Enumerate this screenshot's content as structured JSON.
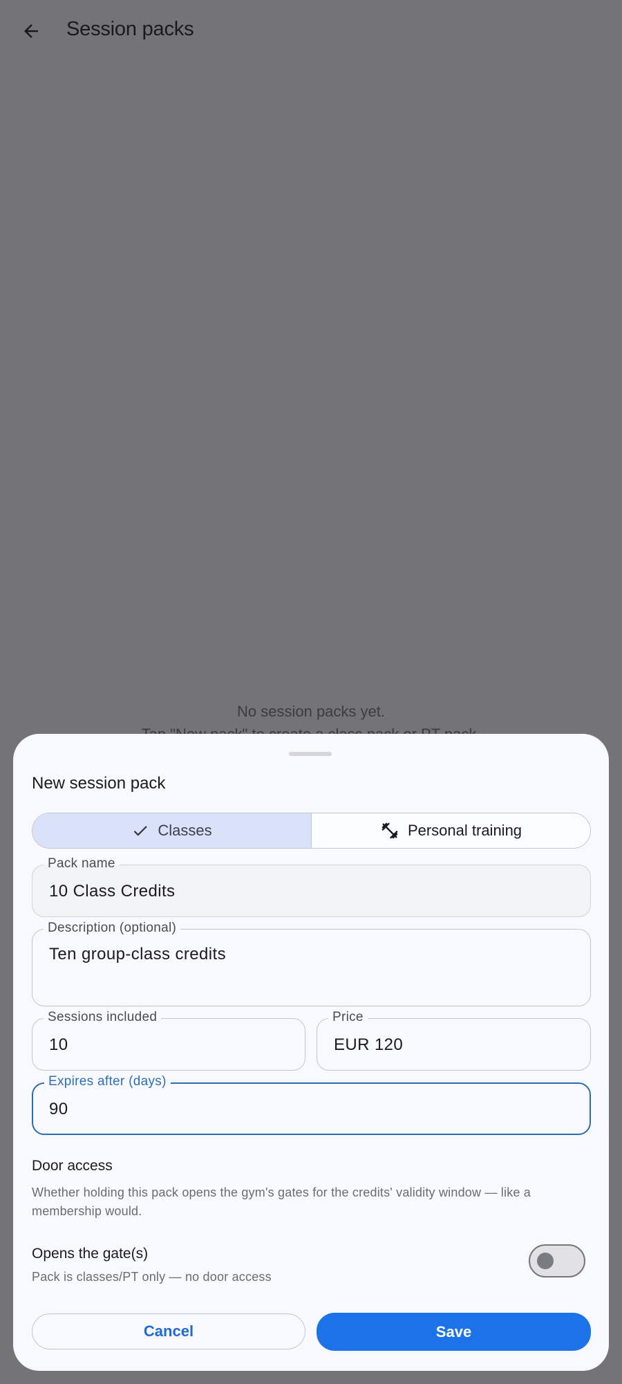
{
  "app_bar": {
    "title": "Session packs"
  },
  "empty_state": {
    "line1": "No session packs yet.",
    "line2": "Tap \"New pack\" to create a class pack or PT pack."
  },
  "sheet": {
    "title": "New session pack",
    "segments": [
      {
        "label": "Classes",
        "icon": "check-icon",
        "selected": true
      },
      {
        "label": "Personal training",
        "icon": "dumbbell-icon",
        "selected": false
      }
    ],
    "fields": {
      "pack_name": {
        "label": "Pack name",
        "value": "10 Class Credits"
      },
      "description": {
        "label": "Description (optional)",
        "value": "Ten group-class credits"
      },
      "sessions": {
        "label": "Sessions included",
        "value": "10"
      },
      "price": {
        "label": "Price",
        "value": "EUR 120"
      },
      "expires": {
        "label": "Expires after (days)",
        "value": "90"
      }
    },
    "door_access": {
      "title": "Door access",
      "description": "Whether holding this pack opens the gym's gates for the credits' validity window — like a membership would."
    },
    "gate_switch": {
      "title": "Opens the gate(s)",
      "subtitle": "Pack is classes/PT only — no door access",
      "on": false
    },
    "actions": {
      "cancel": "Cancel",
      "save": "Save"
    }
  },
  "colors": {
    "accent": "#1c73e8",
    "focus_border": "#2b6cb0",
    "selected_segment": "#dae2f9",
    "scrim": "#747476"
  }
}
